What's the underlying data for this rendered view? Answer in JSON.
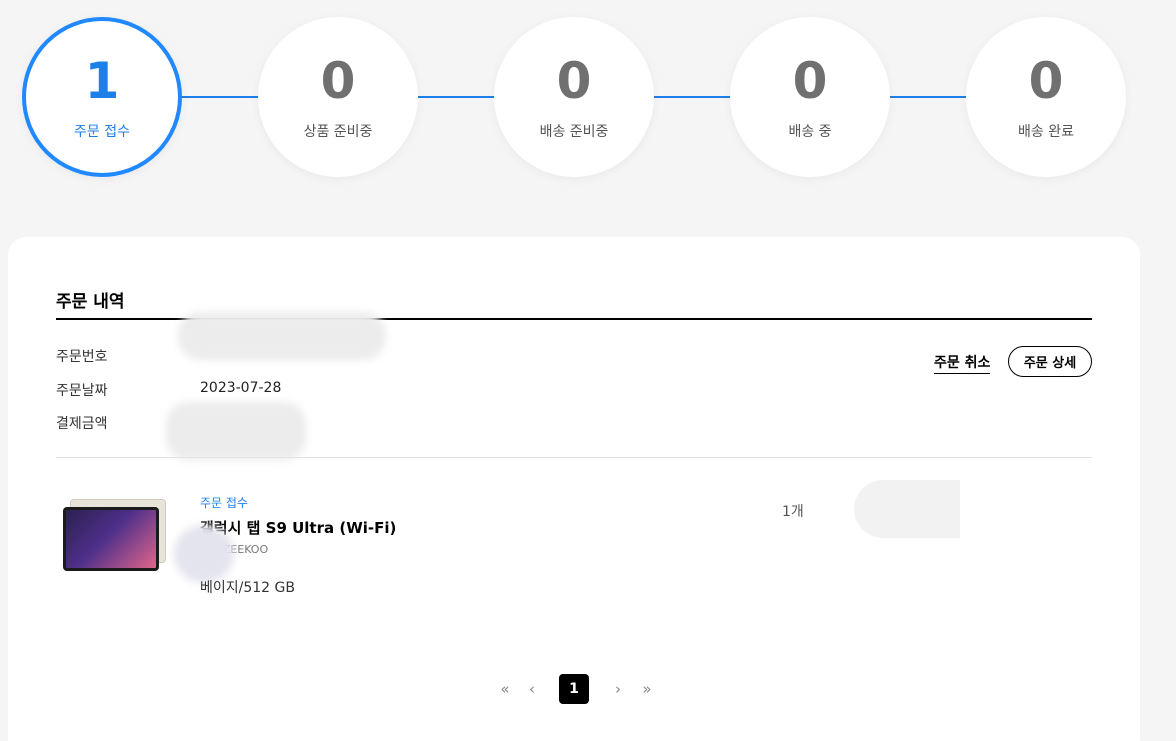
{
  "status_steps": [
    {
      "count": "1",
      "label": "주문 접수",
      "active": true
    },
    {
      "count": "0",
      "label": "상품 준비중",
      "active": false
    },
    {
      "count": "0",
      "label": "배송 준비중",
      "active": false
    },
    {
      "count": "0",
      "label": "배송 중",
      "active": false
    },
    {
      "count": "0",
      "label": "배송 완료",
      "active": false
    }
  ],
  "colors": {
    "accent": "#1f7fe8",
    "background": "#f5f5f5"
  },
  "order": {
    "title": "주문 내역",
    "number_label": "주문번호",
    "date_label": "주문날짜",
    "date_value": "2023-07-28",
    "amount_label": "결제금액",
    "cancel_label": "주문 취소",
    "detail_label": "주문 상세"
  },
  "item": {
    "status": "주문 접수",
    "name": "갤럭시 탭 S9 Ultra (Wi-Fi)",
    "code": "V0NZEEKOO",
    "option": "베이지/512 GB",
    "quantity": "1개"
  },
  "pagination": {
    "first": "«",
    "prev": "‹",
    "current": "1",
    "next": "›",
    "last": "»"
  }
}
